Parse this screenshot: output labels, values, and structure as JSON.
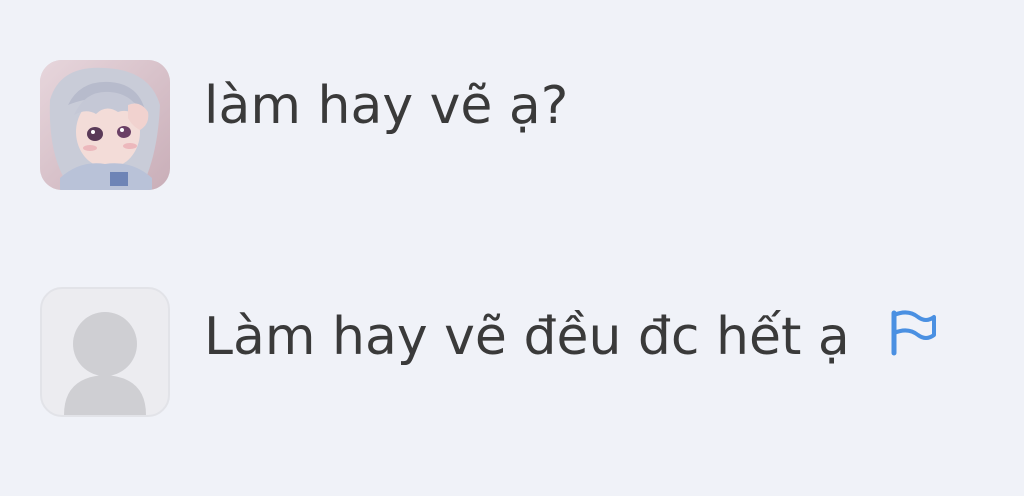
{
  "comments": [
    {
      "avatar_icon": "user-photo-avatar",
      "text": "làm hay vẽ ạ?"
    },
    {
      "avatar_icon": "default-user-avatar",
      "text": "Làm hay vẽ đều đc hết ạ",
      "action_icon": "flag-icon"
    }
  ],
  "colors": {
    "background": "#f0f2f8",
    "text": "#3a3a3a",
    "flag": "#4a90e2",
    "default_avatar_bg": "#ececf0",
    "default_avatar_figure": "#cfcfd3"
  }
}
